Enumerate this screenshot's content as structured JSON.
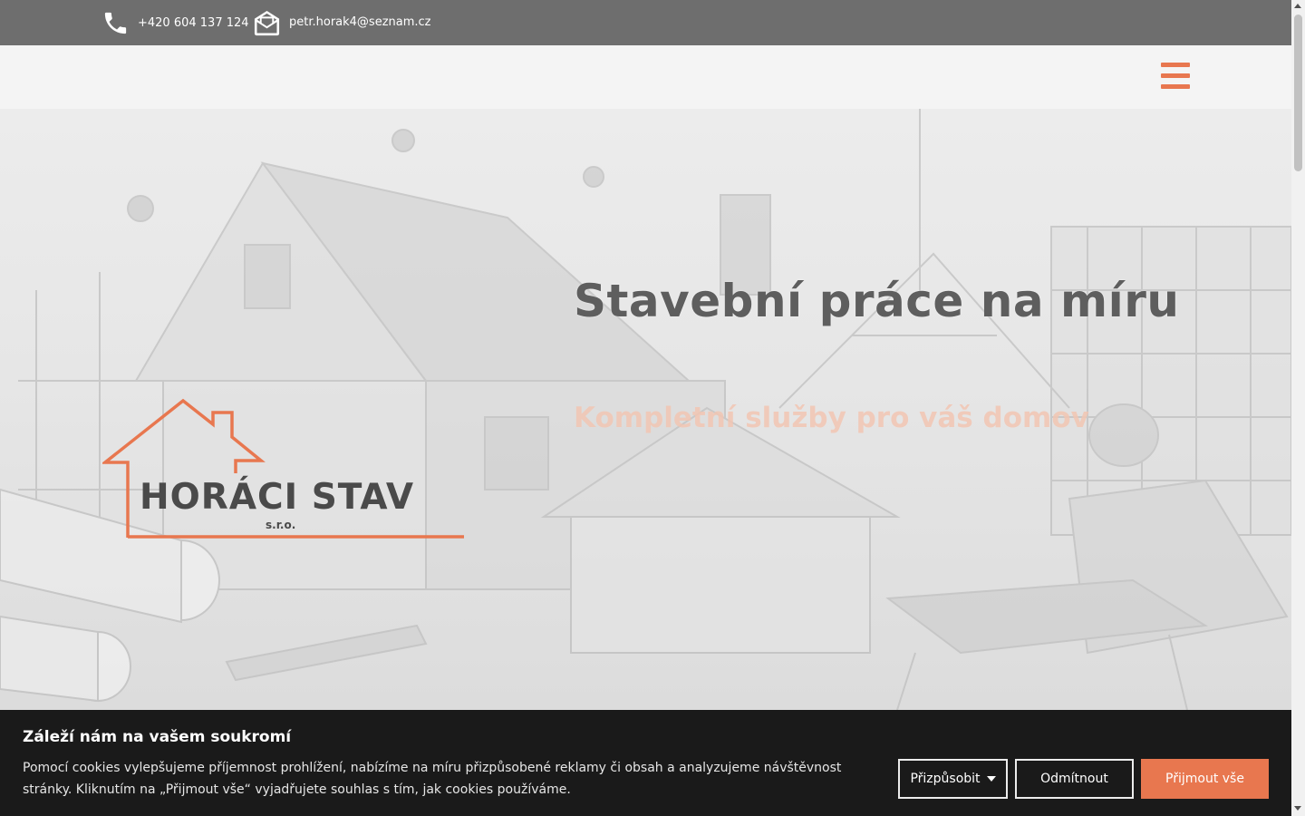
{
  "topbar": {
    "phone": "+420 604 137 124",
    "email": "petr.horak4@seznam.cz",
    "phone_icon": "phone-icon",
    "email_icon": "envelope-icon"
  },
  "header": {
    "menu_icon": "hamburger-menu-icon",
    "accent_color": "#e8774f"
  },
  "hero": {
    "title": "Stavební práce na míru",
    "subtitle": "Kompletní služby pro váš domov"
  },
  "logo": {
    "name": "HORÁCI STAV",
    "suffix": "s.r.o."
  },
  "cookie_banner": {
    "title": "Záleží nám na vašem soukromí",
    "text": "Pomocí cookies vylepšujeme příjemnost prohlížení, nabízíme na míru přizpůsobené reklamy či obsah a analyzujeme návštěvnost stránky. Kliknutím na „Přijmout vše“ vyjadřujete souhlas s tím, jak cookies používáme.",
    "customize_label": "Přizpůsobit",
    "reject_label": "Odmítnout",
    "accept_label": "Přijmout vše"
  }
}
